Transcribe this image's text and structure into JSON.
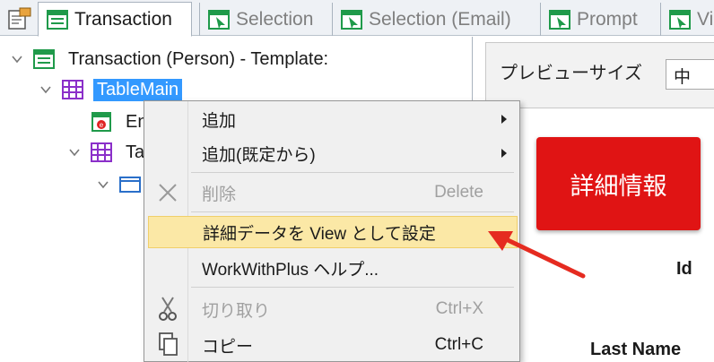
{
  "tabs": [
    {
      "label": "Transaction",
      "active": true
    },
    {
      "label": "Selection",
      "active": false
    },
    {
      "label": "Selection (Email)",
      "active": false
    },
    {
      "label": "Prompt",
      "active": false
    },
    {
      "label": "Vi",
      "active": false
    }
  ],
  "tree": {
    "root": "Transaction (Person) - Template:",
    "table_main": "TableMain",
    "child_e": "En",
    "child_ta": "Ta"
  },
  "right_panel": {
    "preview_label": "プレビューサイズ",
    "preview_value": "中",
    "detail_button": "詳細情報",
    "field_id": "Id",
    "field_last_name": "Last Name"
  },
  "context_menu": {
    "items": [
      {
        "label": "追加",
        "submenu": true
      },
      {
        "label": "追加(既定から)",
        "submenu": true
      },
      {
        "label": "削除",
        "shortcut": "Delete",
        "disabled": true
      },
      {
        "label": "詳細データを View として設定",
        "highlighted": true
      },
      {
        "label": "WorkWithPlus ヘルプ..."
      },
      {
        "label": "切り取り",
        "shortcut": "Ctrl+X",
        "disabled": true
      },
      {
        "label": "コピー",
        "shortcut": "Ctrl+C"
      }
    ]
  },
  "colors": {
    "accent_red": "#e01414",
    "selection_blue": "#3399ff",
    "highlight_yellow": "#fbe8a6",
    "annotation_arrow": "#e52b20"
  }
}
